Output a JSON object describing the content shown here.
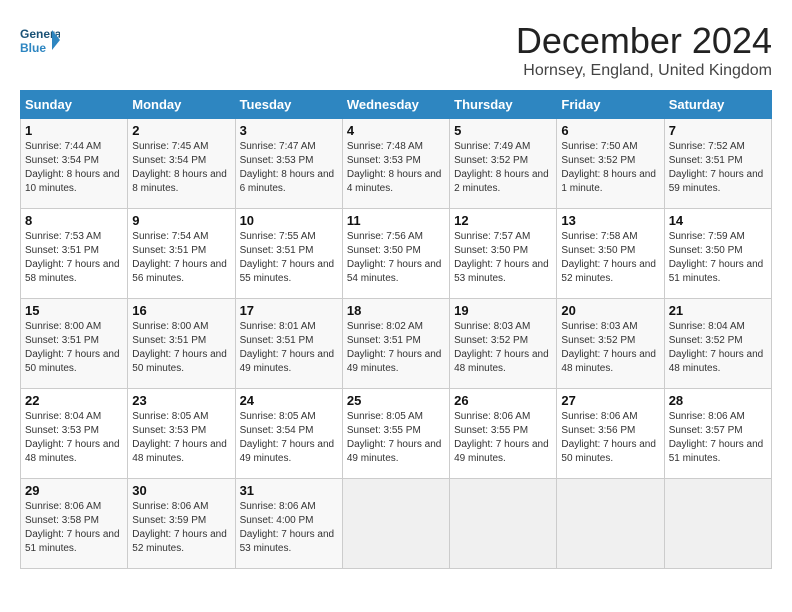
{
  "logo": {
    "general": "General",
    "blue": "Blue"
  },
  "title": "December 2024",
  "subtitle": "Hornsey, England, United Kingdom",
  "days_of_week": [
    "Sunday",
    "Monday",
    "Tuesday",
    "Wednesday",
    "Thursday",
    "Friday",
    "Saturday"
  ],
  "weeks": [
    [
      {
        "day": "1",
        "sunrise": "7:44 AM",
        "sunset": "3:54 PM",
        "daylight": "8 hours and 10 minutes."
      },
      {
        "day": "2",
        "sunrise": "7:45 AM",
        "sunset": "3:54 PM",
        "daylight": "8 hours and 8 minutes."
      },
      {
        "day": "3",
        "sunrise": "7:47 AM",
        "sunset": "3:53 PM",
        "daylight": "8 hours and 6 minutes."
      },
      {
        "day": "4",
        "sunrise": "7:48 AM",
        "sunset": "3:53 PM",
        "daylight": "8 hours and 4 minutes."
      },
      {
        "day": "5",
        "sunrise": "7:49 AM",
        "sunset": "3:52 PM",
        "daylight": "8 hours and 2 minutes."
      },
      {
        "day": "6",
        "sunrise": "7:50 AM",
        "sunset": "3:52 PM",
        "daylight": "8 hours and 1 minute."
      },
      {
        "day": "7",
        "sunrise": "7:52 AM",
        "sunset": "3:51 PM",
        "daylight": "7 hours and 59 minutes."
      }
    ],
    [
      {
        "day": "8",
        "sunrise": "7:53 AM",
        "sunset": "3:51 PM",
        "daylight": "7 hours and 58 minutes."
      },
      {
        "day": "9",
        "sunrise": "7:54 AM",
        "sunset": "3:51 PM",
        "daylight": "7 hours and 56 minutes."
      },
      {
        "day": "10",
        "sunrise": "7:55 AM",
        "sunset": "3:51 PM",
        "daylight": "7 hours and 55 minutes."
      },
      {
        "day": "11",
        "sunrise": "7:56 AM",
        "sunset": "3:50 PM",
        "daylight": "7 hours and 54 minutes."
      },
      {
        "day": "12",
        "sunrise": "7:57 AM",
        "sunset": "3:50 PM",
        "daylight": "7 hours and 53 minutes."
      },
      {
        "day": "13",
        "sunrise": "7:58 AM",
        "sunset": "3:50 PM",
        "daylight": "7 hours and 52 minutes."
      },
      {
        "day": "14",
        "sunrise": "7:59 AM",
        "sunset": "3:50 PM",
        "daylight": "7 hours and 51 minutes."
      }
    ],
    [
      {
        "day": "15",
        "sunrise": "8:00 AM",
        "sunset": "3:51 PM",
        "daylight": "7 hours and 50 minutes."
      },
      {
        "day": "16",
        "sunrise": "8:00 AM",
        "sunset": "3:51 PM",
        "daylight": "7 hours and 50 minutes."
      },
      {
        "day": "17",
        "sunrise": "8:01 AM",
        "sunset": "3:51 PM",
        "daylight": "7 hours and 49 minutes."
      },
      {
        "day": "18",
        "sunrise": "8:02 AM",
        "sunset": "3:51 PM",
        "daylight": "7 hours and 49 minutes."
      },
      {
        "day": "19",
        "sunrise": "8:03 AM",
        "sunset": "3:52 PM",
        "daylight": "7 hours and 48 minutes."
      },
      {
        "day": "20",
        "sunrise": "8:03 AM",
        "sunset": "3:52 PM",
        "daylight": "7 hours and 48 minutes."
      },
      {
        "day": "21",
        "sunrise": "8:04 AM",
        "sunset": "3:52 PM",
        "daylight": "7 hours and 48 minutes."
      }
    ],
    [
      {
        "day": "22",
        "sunrise": "8:04 AM",
        "sunset": "3:53 PM",
        "daylight": "7 hours and 48 minutes."
      },
      {
        "day": "23",
        "sunrise": "8:05 AM",
        "sunset": "3:53 PM",
        "daylight": "7 hours and 48 minutes."
      },
      {
        "day": "24",
        "sunrise": "8:05 AM",
        "sunset": "3:54 PM",
        "daylight": "7 hours and 49 minutes."
      },
      {
        "day": "25",
        "sunrise": "8:05 AM",
        "sunset": "3:55 PM",
        "daylight": "7 hours and 49 minutes."
      },
      {
        "day": "26",
        "sunrise": "8:06 AM",
        "sunset": "3:55 PM",
        "daylight": "7 hours and 49 minutes."
      },
      {
        "day": "27",
        "sunrise": "8:06 AM",
        "sunset": "3:56 PM",
        "daylight": "7 hours and 50 minutes."
      },
      {
        "day": "28",
        "sunrise": "8:06 AM",
        "sunset": "3:57 PM",
        "daylight": "7 hours and 51 minutes."
      }
    ],
    [
      {
        "day": "29",
        "sunrise": "8:06 AM",
        "sunset": "3:58 PM",
        "daylight": "7 hours and 51 minutes."
      },
      {
        "day": "30",
        "sunrise": "8:06 AM",
        "sunset": "3:59 PM",
        "daylight": "7 hours and 52 minutes."
      },
      {
        "day": "31",
        "sunrise": "8:06 AM",
        "sunset": "4:00 PM",
        "daylight": "7 hours and 53 minutes."
      },
      null,
      null,
      null,
      null
    ]
  ]
}
